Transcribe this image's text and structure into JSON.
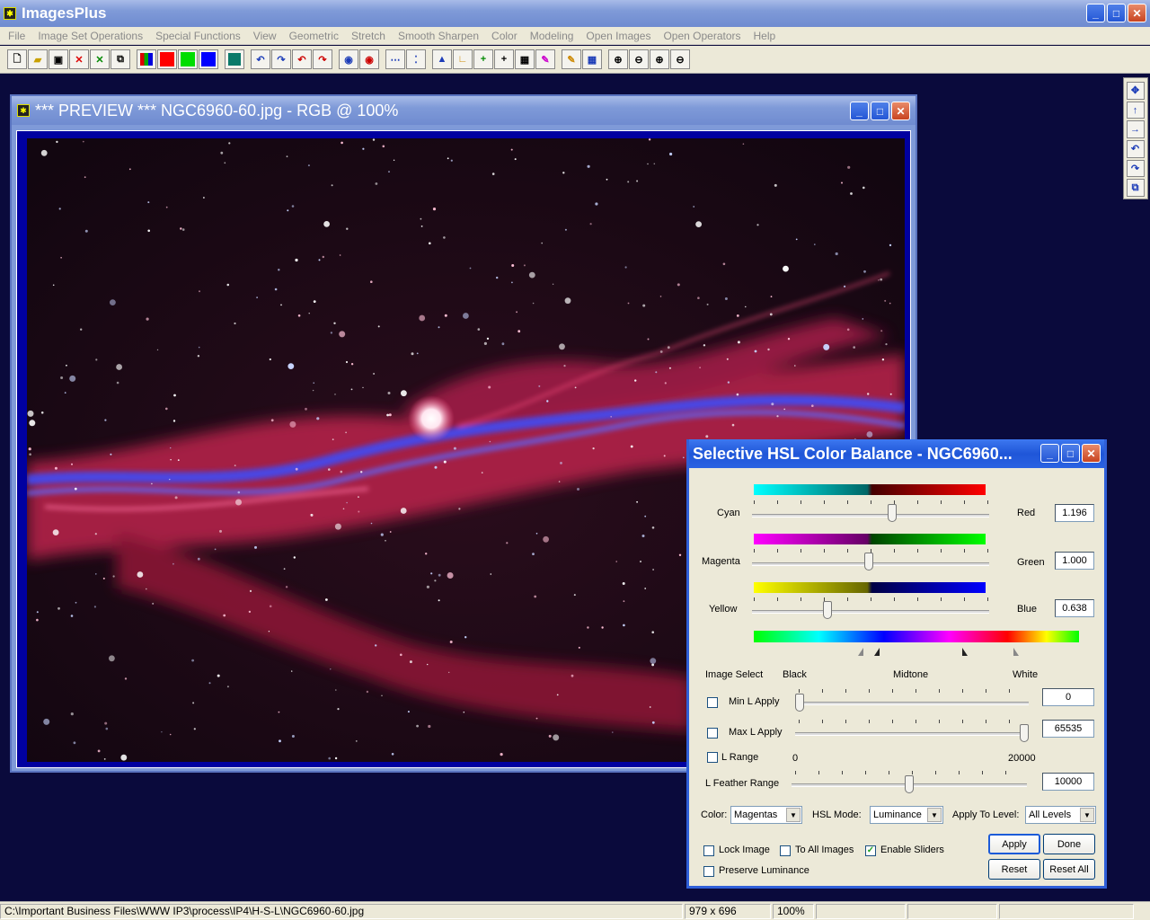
{
  "app": {
    "title": "ImagesPlus"
  },
  "menu": [
    "File",
    "Image Set Operations",
    "Special Functions",
    "View",
    "Geometric",
    "Stretch",
    "Smooth Sharpen",
    "Color",
    "Modeling",
    "Open Images",
    "Open Operators",
    "Help"
  ],
  "preview": {
    "title": "*** PREVIEW *** NGC6960-60.jpg - RGB @  100%"
  },
  "dialog": {
    "title": "Selective HSL Color Balance - NGC6960...",
    "cyan_label": "Cyan",
    "red_label": "Red",
    "red_value": "1.196",
    "red_level": 0.6,
    "magenta_label": "Magenta",
    "green_label": "Green",
    "green_value": "1.000",
    "green_level": 0.5,
    "yellow_label": "Yellow",
    "blue_label": "Blue",
    "blue_value": "0.638",
    "blue_level": 0.32,
    "image_select": "Image Select",
    "black": "Black",
    "midtone": "Midtone",
    "white": "White",
    "min_l_apply": "Min L Apply",
    "min_l_value": "0",
    "max_l_apply": "Max L Apply",
    "max_l_value": "65535",
    "l_range": "L Range",
    "l_range_min": "0",
    "l_range_max": "20000",
    "l_feather_range": "L Feather Range",
    "l_feather_value": "10000",
    "l_feather_level": 0.5,
    "color_label": "Color:",
    "color_value": "Magentas",
    "hsl_mode_label": "HSL Mode:",
    "hsl_mode_value": "Luminance",
    "apply_level_label": "Apply To Level:",
    "apply_level_value": "All Levels",
    "lock_image": "Lock Image",
    "to_all_images": "To All Images",
    "enable_sliders": "Enable Sliders",
    "preserve_luminance": "Preserve Luminance",
    "apply": "Apply",
    "done": "Done",
    "reset": "Reset",
    "reset_all": "Reset All"
  },
  "status": {
    "path": "C:\\Important Business Files\\WWW IP3\\process\\IP4\\H-S-L\\NGC6960-60.jpg",
    "dimensions": "979 x 696",
    "zoom": "100%"
  }
}
